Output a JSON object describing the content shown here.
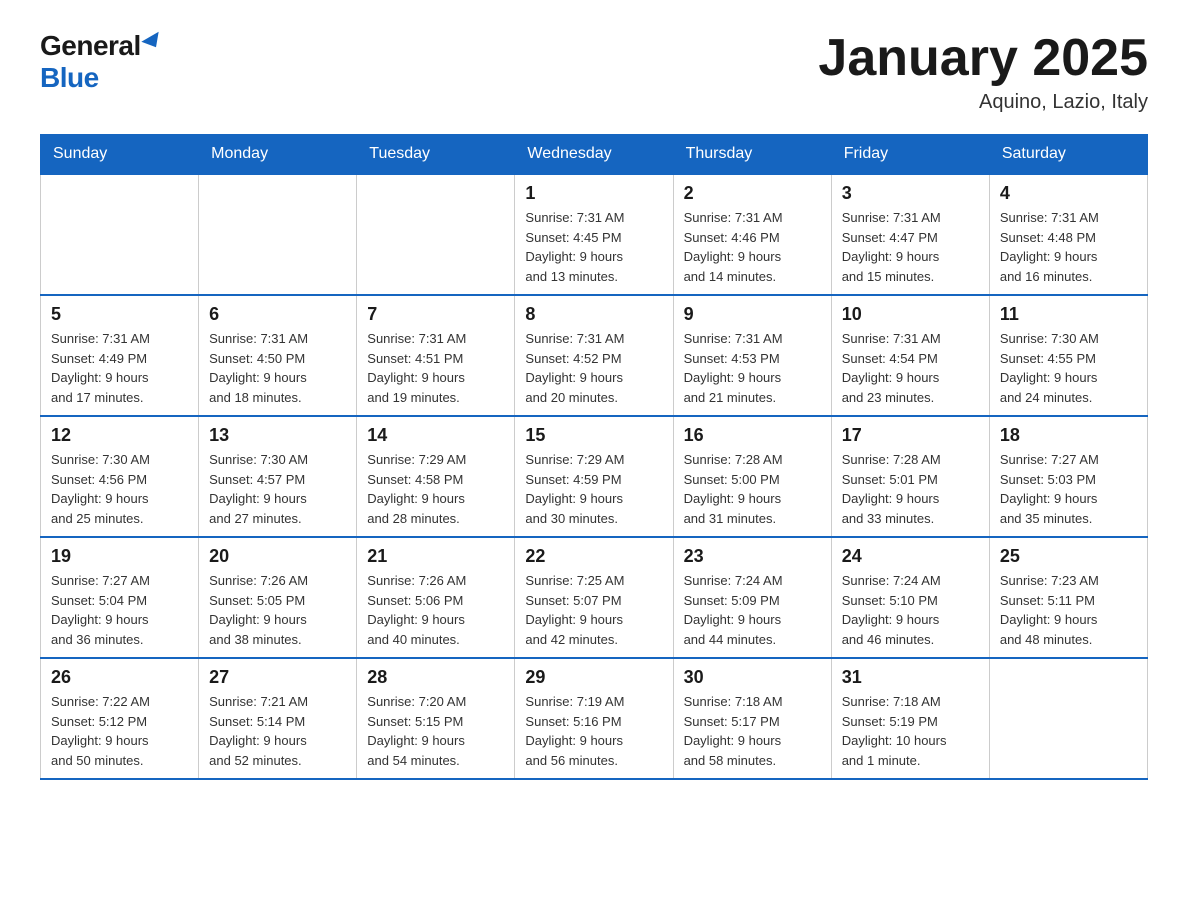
{
  "logo": {
    "general": "General",
    "blue": "Blue"
  },
  "title": "January 2025",
  "subtitle": "Aquino, Lazio, Italy",
  "weekdays": [
    "Sunday",
    "Monday",
    "Tuesday",
    "Wednesday",
    "Thursday",
    "Friday",
    "Saturday"
  ],
  "weeks": [
    [
      {
        "day": "",
        "info": ""
      },
      {
        "day": "",
        "info": ""
      },
      {
        "day": "",
        "info": ""
      },
      {
        "day": "1",
        "info": "Sunrise: 7:31 AM\nSunset: 4:45 PM\nDaylight: 9 hours\nand 13 minutes."
      },
      {
        "day": "2",
        "info": "Sunrise: 7:31 AM\nSunset: 4:46 PM\nDaylight: 9 hours\nand 14 minutes."
      },
      {
        "day": "3",
        "info": "Sunrise: 7:31 AM\nSunset: 4:47 PM\nDaylight: 9 hours\nand 15 minutes."
      },
      {
        "day": "4",
        "info": "Sunrise: 7:31 AM\nSunset: 4:48 PM\nDaylight: 9 hours\nand 16 minutes."
      }
    ],
    [
      {
        "day": "5",
        "info": "Sunrise: 7:31 AM\nSunset: 4:49 PM\nDaylight: 9 hours\nand 17 minutes."
      },
      {
        "day": "6",
        "info": "Sunrise: 7:31 AM\nSunset: 4:50 PM\nDaylight: 9 hours\nand 18 minutes."
      },
      {
        "day": "7",
        "info": "Sunrise: 7:31 AM\nSunset: 4:51 PM\nDaylight: 9 hours\nand 19 minutes."
      },
      {
        "day": "8",
        "info": "Sunrise: 7:31 AM\nSunset: 4:52 PM\nDaylight: 9 hours\nand 20 minutes."
      },
      {
        "day": "9",
        "info": "Sunrise: 7:31 AM\nSunset: 4:53 PM\nDaylight: 9 hours\nand 21 minutes."
      },
      {
        "day": "10",
        "info": "Sunrise: 7:31 AM\nSunset: 4:54 PM\nDaylight: 9 hours\nand 23 minutes."
      },
      {
        "day": "11",
        "info": "Sunrise: 7:30 AM\nSunset: 4:55 PM\nDaylight: 9 hours\nand 24 minutes."
      }
    ],
    [
      {
        "day": "12",
        "info": "Sunrise: 7:30 AM\nSunset: 4:56 PM\nDaylight: 9 hours\nand 25 minutes."
      },
      {
        "day": "13",
        "info": "Sunrise: 7:30 AM\nSunset: 4:57 PM\nDaylight: 9 hours\nand 27 minutes."
      },
      {
        "day": "14",
        "info": "Sunrise: 7:29 AM\nSunset: 4:58 PM\nDaylight: 9 hours\nand 28 minutes."
      },
      {
        "day": "15",
        "info": "Sunrise: 7:29 AM\nSunset: 4:59 PM\nDaylight: 9 hours\nand 30 minutes."
      },
      {
        "day": "16",
        "info": "Sunrise: 7:28 AM\nSunset: 5:00 PM\nDaylight: 9 hours\nand 31 minutes."
      },
      {
        "day": "17",
        "info": "Sunrise: 7:28 AM\nSunset: 5:01 PM\nDaylight: 9 hours\nand 33 minutes."
      },
      {
        "day": "18",
        "info": "Sunrise: 7:27 AM\nSunset: 5:03 PM\nDaylight: 9 hours\nand 35 minutes."
      }
    ],
    [
      {
        "day": "19",
        "info": "Sunrise: 7:27 AM\nSunset: 5:04 PM\nDaylight: 9 hours\nand 36 minutes."
      },
      {
        "day": "20",
        "info": "Sunrise: 7:26 AM\nSunset: 5:05 PM\nDaylight: 9 hours\nand 38 minutes."
      },
      {
        "day": "21",
        "info": "Sunrise: 7:26 AM\nSunset: 5:06 PM\nDaylight: 9 hours\nand 40 minutes."
      },
      {
        "day": "22",
        "info": "Sunrise: 7:25 AM\nSunset: 5:07 PM\nDaylight: 9 hours\nand 42 minutes."
      },
      {
        "day": "23",
        "info": "Sunrise: 7:24 AM\nSunset: 5:09 PM\nDaylight: 9 hours\nand 44 minutes."
      },
      {
        "day": "24",
        "info": "Sunrise: 7:24 AM\nSunset: 5:10 PM\nDaylight: 9 hours\nand 46 minutes."
      },
      {
        "day": "25",
        "info": "Sunrise: 7:23 AM\nSunset: 5:11 PM\nDaylight: 9 hours\nand 48 minutes."
      }
    ],
    [
      {
        "day": "26",
        "info": "Sunrise: 7:22 AM\nSunset: 5:12 PM\nDaylight: 9 hours\nand 50 minutes."
      },
      {
        "day": "27",
        "info": "Sunrise: 7:21 AM\nSunset: 5:14 PM\nDaylight: 9 hours\nand 52 minutes."
      },
      {
        "day": "28",
        "info": "Sunrise: 7:20 AM\nSunset: 5:15 PM\nDaylight: 9 hours\nand 54 minutes."
      },
      {
        "day": "29",
        "info": "Sunrise: 7:19 AM\nSunset: 5:16 PM\nDaylight: 9 hours\nand 56 minutes."
      },
      {
        "day": "30",
        "info": "Sunrise: 7:18 AM\nSunset: 5:17 PM\nDaylight: 9 hours\nand 58 minutes."
      },
      {
        "day": "31",
        "info": "Sunrise: 7:18 AM\nSunset: 5:19 PM\nDaylight: 10 hours\nand 1 minute."
      },
      {
        "day": "",
        "info": ""
      }
    ]
  ]
}
